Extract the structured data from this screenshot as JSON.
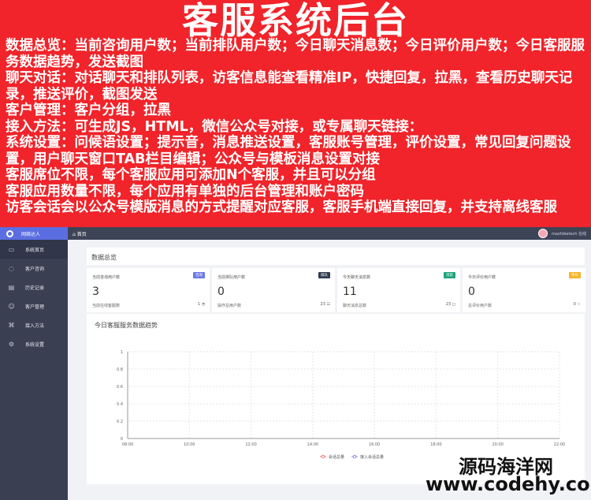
{
  "banner": {
    "title": "客服系统后台",
    "lines": [
      "数据总览：当前咨询用户数；当前排队用户数；今日聊天消息数；今日评价用户数；今日客服服务数据趋势，发送截图",
      "聊天对话：对话聊天和排队列表，访客信息能查看精准IP，快捷回复，拉黑，查看历史聊天记录，推送评价，截图发送",
      "客户管理：客户分组，拉黑",
      "接入方法：可生成JS，HTML，微信公众号对接，或专属聊天链接：",
      "系统设置：问候语设置；提示音，消息推送设置，客服账号管理，评价设置，常见回复问题设置，用户聊天窗口TAB栏目编辑；公众号与模板消息设置对接",
      "客服席位不限，每个客服应用可添加N个客服，并且可以分组",
      "客服应用数量不限，每个应用有单独的后台管理和账户密码",
      "访客会话会以公众号模版消息的方式提醒对应客服，客服手机端直接回复，并支持离线客服"
    ]
  },
  "sidebar": {
    "logo_text": "网络达人",
    "items": [
      {
        "label": "系统首页",
        "icon": "monitor-icon"
      },
      {
        "label": "客户咨询",
        "icon": "chat-icon"
      },
      {
        "label": "历史记录",
        "icon": "document-icon"
      },
      {
        "label": "客户管理",
        "icon": "user-icon"
      },
      {
        "label": "接入方法",
        "icon": "plugin-icon"
      },
      {
        "label": "系统设置",
        "icon": "gear-icon"
      }
    ]
  },
  "topbar": {
    "home_tab": "首页",
    "user_name": "mazhibetech 在线"
  },
  "overview": {
    "title": "数据总览",
    "cards": [
      {
        "title": "当前咨询用户数",
        "badge": "咨询",
        "badge_color": "#6a78e6",
        "value": "3",
        "sub": "当前在线客服数",
        "num": "1"
      },
      {
        "title": "当前排队用户数",
        "badge": "排队",
        "badge_color": "#2f3a4e",
        "value": "0",
        "sub": "操作总用户数",
        "num": "23"
      },
      {
        "title": "今天聊天消息数",
        "badge": "消息",
        "badge_color": "#1aa37a",
        "value": "11",
        "sub": "聊天消息总数",
        "num": "23"
      },
      {
        "title": "今日评价用户数",
        "badge": "评价",
        "badge_color": "#f5b52b",
        "value": "0",
        "sub": "总评价用户数",
        "num": "0"
      }
    ]
  },
  "chart_data": {
    "type": "line",
    "title": "今日客服服务数据趋势",
    "x": [
      "08:00",
      "10:00",
      "12:00",
      "14:00",
      "16:00",
      "18:00",
      "20:00",
      "22:00"
    ],
    "yticks": [
      0,
      0.2,
      0.4,
      0.6,
      0.8,
      1
    ],
    "ylim": [
      0,
      1
    ],
    "series": [
      {
        "name": "会话总量",
        "color": "#f07a7a",
        "values": []
      },
      {
        "name": "接入会话总量",
        "color": "#8a8cf0",
        "values": []
      }
    ],
    "grid": true,
    "legend": "bottom"
  },
  "watermark": {
    "line1": "源码海洋网",
    "line2": "www.codehy.com"
  }
}
